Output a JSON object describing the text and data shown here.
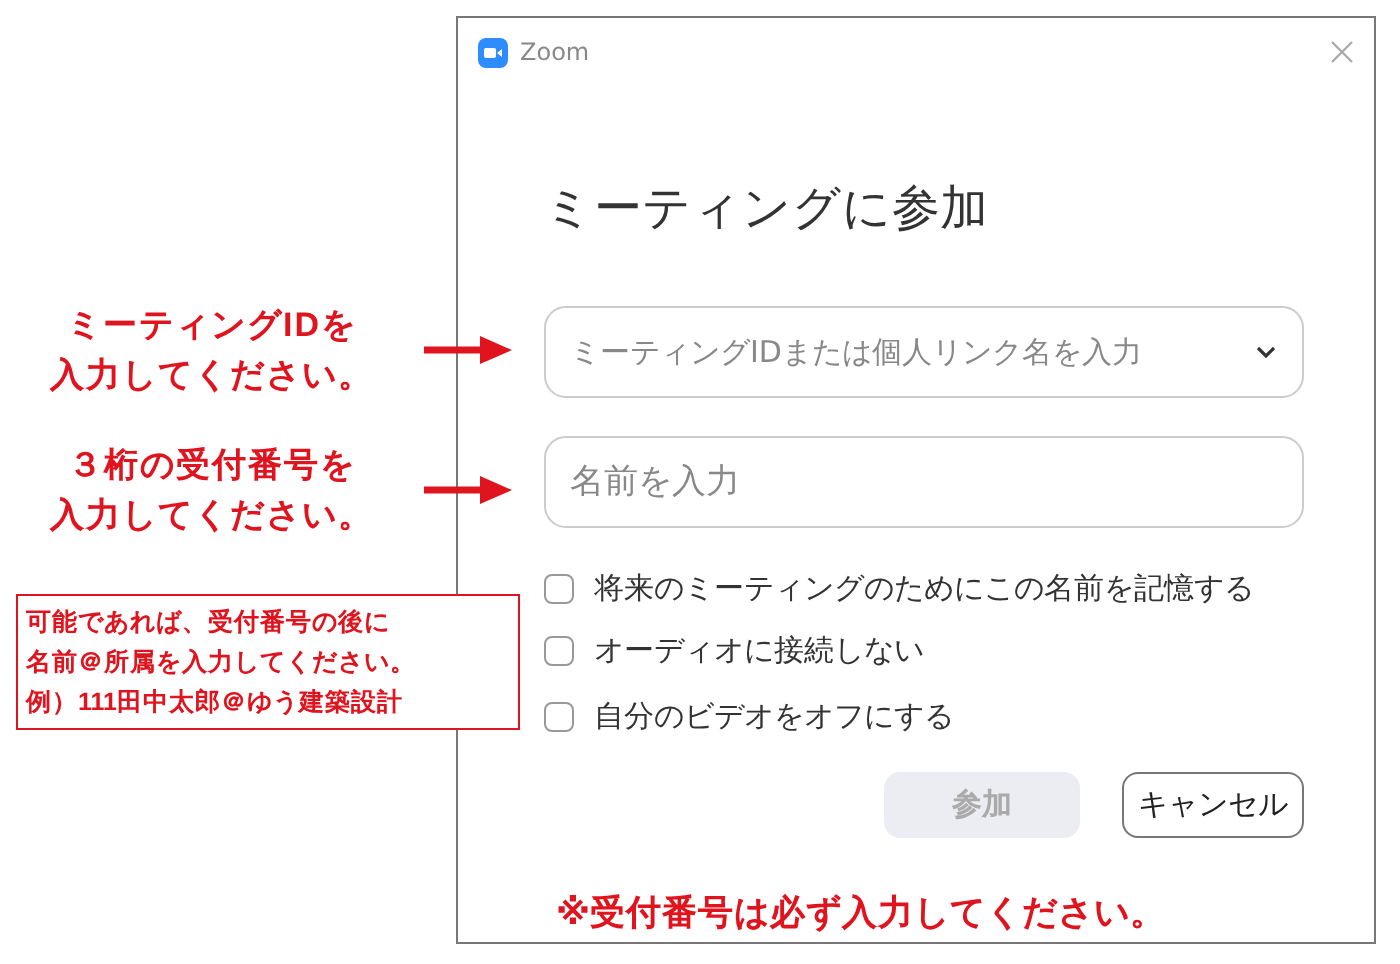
{
  "annotations": [
    {
      "kind": "callout",
      "lines": [
        "ミーティングIDを",
        "入力してください。"
      ]
    },
    {
      "kind": "callout",
      "lines": [
        "３桁の受付番号を",
        "入力してください。"
      ]
    },
    {
      "kind": "note",
      "lines": [
        "可能であれば、受付番号の後に",
        "名前＠所属を入力してください。",
        "例）111田中太郎＠ゆう建築設計"
      ]
    }
  ],
  "window": {
    "title": "Zoom",
    "heading": "ミーティングに参加",
    "meeting_id_field": {
      "placeholder": "ミーティングIDまたは個人リンク名を入力"
    },
    "name_field": {
      "placeholder": "名前を入力"
    },
    "options": [
      {
        "label": "将来のミーティングのためにこの名前を記憶する",
        "checked": false
      },
      {
        "label": "オーディオに接続しない",
        "checked": false
      },
      {
        "label": "自分のビデオをオフにする",
        "checked": false
      }
    ],
    "buttons": [
      {
        "label": "参加",
        "disabled": true
      },
      {
        "label": "キャンセル",
        "disabled": false
      }
    ],
    "notice": "※受付番号は必ず入力してください。"
  }
}
